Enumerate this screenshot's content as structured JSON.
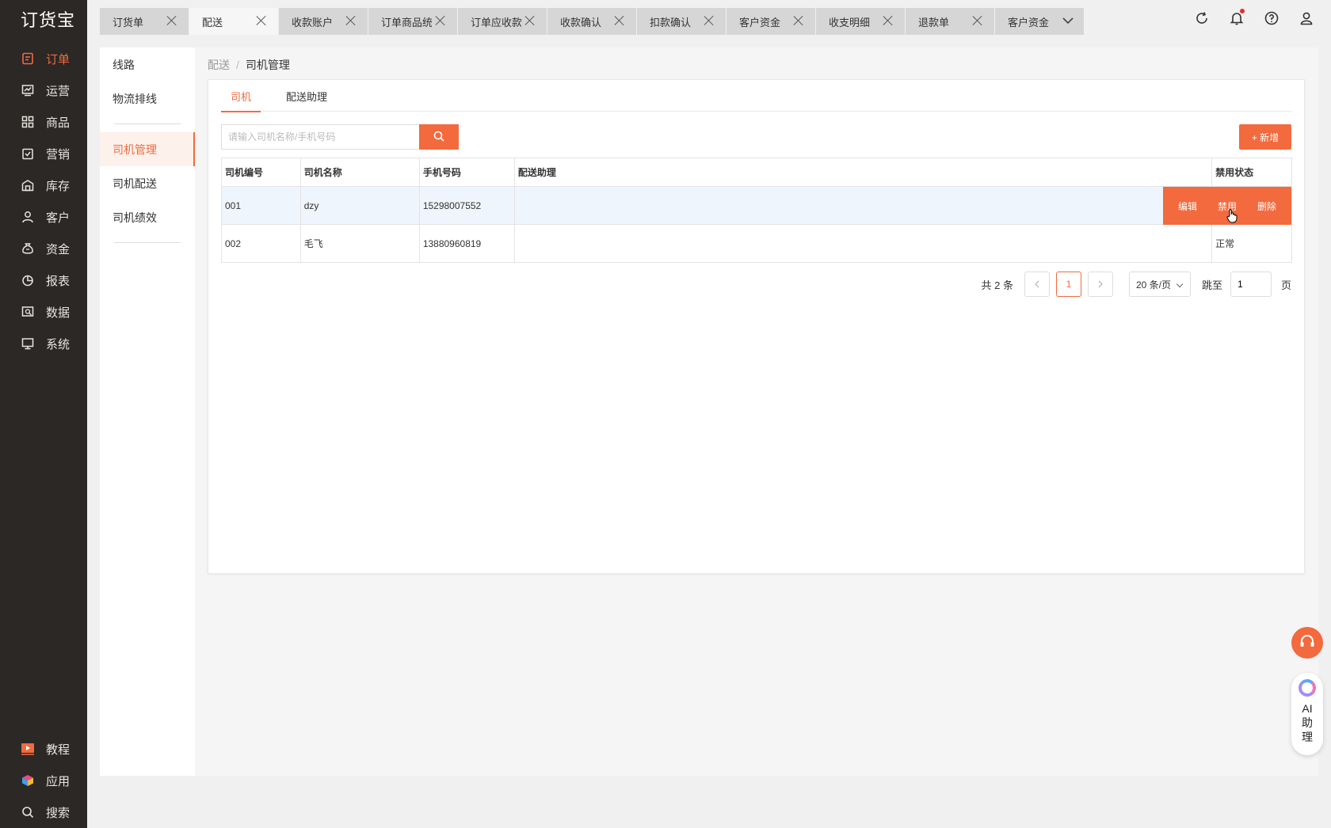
{
  "app": {
    "logo": "订货宝"
  },
  "sidebar": {
    "items": [
      {
        "label": "订单",
        "icon": "order-icon",
        "active": true
      },
      {
        "label": "运营",
        "icon": "operation-icon"
      },
      {
        "label": "商品",
        "icon": "goods-icon"
      },
      {
        "label": "营销",
        "icon": "marketing-icon"
      },
      {
        "label": "库存",
        "icon": "warehouse-icon"
      },
      {
        "label": "客户",
        "icon": "customer-icon"
      },
      {
        "label": "资金",
        "icon": "money-bag-icon"
      },
      {
        "label": "报表",
        "icon": "pie-chart-icon"
      },
      {
        "label": "数据",
        "icon": "data-icon"
      },
      {
        "label": "系统",
        "icon": "monitor-icon"
      }
    ],
    "bottom": [
      {
        "label": "教程",
        "icon": "video-icon"
      },
      {
        "label": "应用",
        "icon": "cube-icon"
      },
      {
        "label": "搜索",
        "icon": "search-icon"
      }
    ]
  },
  "tabs": [
    {
      "label": "订货单"
    },
    {
      "label": "配送",
      "active": true
    },
    {
      "label": "收款账户"
    },
    {
      "label": "订单商品统计"
    },
    {
      "label": "订单应收款"
    },
    {
      "label": "收款确认"
    },
    {
      "label": "扣款确认"
    },
    {
      "label": "客户资金"
    },
    {
      "label": "收支明细"
    },
    {
      "label": "退款单"
    },
    {
      "label": "客户资金"
    }
  ],
  "submenu": {
    "group1": [
      "线路",
      "物流排线"
    ],
    "group2": [
      "司机管理",
      "司机配送",
      "司机绩效"
    ],
    "active": "司机管理"
  },
  "breadcrumb": {
    "parent": "配送",
    "sep": "/",
    "current": "司机管理"
  },
  "inner_tabs": [
    "司机",
    "配送助理"
  ],
  "search": {
    "placeholder": "请输入司机名称/手机号码"
  },
  "add_button": "+ 新增",
  "table": {
    "headers": [
      "司机编号",
      "司机名称",
      "手机号码",
      "配送助理",
      "禁用状态"
    ],
    "rows": [
      {
        "id": "001",
        "name": "dzy",
        "phone": "15298007552",
        "assistant": "",
        "status": ""
      },
      {
        "id": "002",
        "name": "毛飞",
        "phone": "13880960819",
        "assistant": "",
        "status": "正常"
      }
    ],
    "row_ops": [
      "编辑",
      "禁用",
      "删除"
    ]
  },
  "pager": {
    "total": "共 2 条",
    "current": "1",
    "size": "20 条/页",
    "jump_label": "跳至",
    "jump_value": "1",
    "page_unit": "页"
  },
  "float": {
    "ai": "AI助理"
  },
  "colors": {
    "accent": "#f26a3d",
    "sidebar_bg": "#2b2826"
  }
}
